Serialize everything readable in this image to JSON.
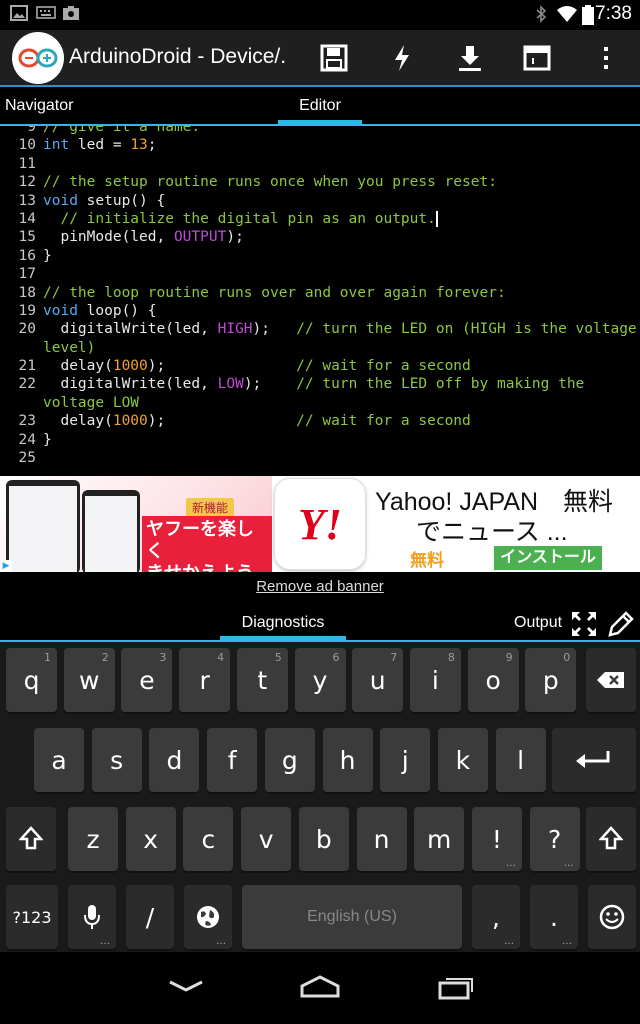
{
  "status_bar": {
    "time": "7:38"
  },
  "action_bar": {
    "title": "ArduinoDroid - Device/."
  },
  "tabs": {
    "navigator": "Navigator",
    "editor": "Editor"
  },
  "code_lines": [
    {
      "num": "9",
      "text": "// give it a name:"
    },
    {
      "num": "10",
      "text": "int led = 13;"
    },
    {
      "num": "11",
      "text": ""
    },
    {
      "num": "12",
      "text": "// the setup routine runs once when you press reset:"
    },
    {
      "num": "13",
      "text": "void setup() {"
    },
    {
      "num": "14",
      "text": "  // initialize the digital pin as an output."
    },
    {
      "num": "15",
      "text": "  pinMode(led, OUTPUT);"
    },
    {
      "num": "16",
      "text": "}"
    },
    {
      "num": "17",
      "text": ""
    },
    {
      "num": "18",
      "text": "// the loop routine runs over and over again forever:"
    },
    {
      "num": "19",
      "text": "void loop() {"
    },
    {
      "num": "20",
      "text": "  digitalWrite(led, HIGH);   // turn the LED on (HIGH is the voltage level)"
    },
    {
      "num": "21",
      "text": "  delay(1000);               // wait for a second"
    },
    {
      "num": "22",
      "text": "  digitalWrite(led, LOW);    // turn the LED off by making the voltage LOW"
    },
    {
      "num": "23",
      "text": "  delay(1000);               // wait for a second"
    },
    {
      "num": "24",
      "text": "}"
    },
    {
      "num": "25",
      "text": ""
    }
  ],
  "ad": {
    "badge": "新機能",
    "headline_1": "ヤフーを楽しく",
    "headline_2": "きせかえよう",
    "brand_logo": "Y!",
    "title_1": "Yahoo! JAPAN　無料",
    "title_2": "でニュース ...",
    "free_label": "無料",
    "install_label": "インストール",
    "remove_banner": "Remove ad banner"
  },
  "bottom_tabs": {
    "diagnostics": "Diagnostics",
    "output": "Output"
  },
  "keyboard": {
    "row1": [
      {
        "k": "q",
        "h": "1"
      },
      {
        "k": "w",
        "h": "2"
      },
      {
        "k": "e",
        "h": "3"
      },
      {
        "k": "r",
        "h": "4"
      },
      {
        "k": "t",
        "h": "5"
      },
      {
        "k": "y",
        "h": "6"
      },
      {
        "k": "u",
        "h": "7"
      },
      {
        "k": "i",
        "h": "8"
      },
      {
        "k": "o",
        "h": "9"
      },
      {
        "k": "p",
        "h": "0"
      }
    ],
    "row2": [
      "a",
      "s",
      "d",
      "f",
      "g",
      "h",
      "j",
      "k",
      "l"
    ],
    "row3": [
      "z",
      "x",
      "c",
      "v",
      "b",
      "n",
      "m",
      "!",
      "?"
    ],
    "symbols_key": "?123",
    "slash_key": "/",
    "space_label": "English (US)",
    "comma_key": ",",
    "period_key": "."
  },
  "colors": {
    "accent": "#33b5e5",
    "keyword": "#56a9f2",
    "comment": "#8dc63f",
    "number": "#f0a030",
    "constant": "#c04bd8"
  }
}
